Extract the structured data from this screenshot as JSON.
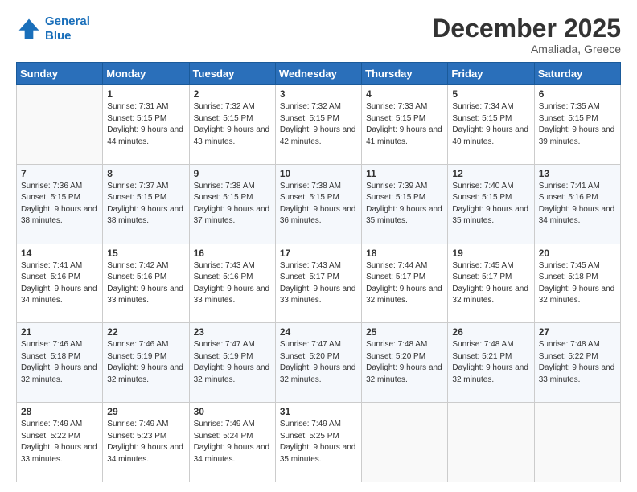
{
  "header": {
    "logo_line1": "General",
    "logo_line2": "Blue",
    "month": "December 2025",
    "location": "Amaliada, Greece"
  },
  "weekdays": [
    "Sunday",
    "Monday",
    "Tuesday",
    "Wednesday",
    "Thursday",
    "Friday",
    "Saturday"
  ],
  "weeks": [
    [
      {
        "day": "",
        "sunrise": "",
        "sunset": "",
        "daylight": ""
      },
      {
        "day": "1",
        "sunrise": "7:31 AM",
        "sunset": "5:15 PM",
        "daylight": "9 hours and 44 minutes."
      },
      {
        "day": "2",
        "sunrise": "7:32 AM",
        "sunset": "5:15 PM",
        "daylight": "9 hours and 43 minutes."
      },
      {
        "day": "3",
        "sunrise": "7:32 AM",
        "sunset": "5:15 PM",
        "daylight": "9 hours and 42 minutes."
      },
      {
        "day": "4",
        "sunrise": "7:33 AM",
        "sunset": "5:15 PM",
        "daylight": "9 hours and 41 minutes."
      },
      {
        "day": "5",
        "sunrise": "7:34 AM",
        "sunset": "5:15 PM",
        "daylight": "9 hours and 40 minutes."
      },
      {
        "day": "6",
        "sunrise": "7:35 AM",
        "sunset": "5:15 PM",
        "daylight": "9 hours and 39 minutes."
      }
    ],
    [
      {
        "day": "7",
        "sunrise": "7:36 AM",
        "sunset": "5:15 PM",
        "daylight": "9 hours and 38 minutes."
      },
      {
        "day": "8",
        "sunrise": "7:37 AM",
        "sunset": "5:15 PM",
        "daylight": "9 hours and 38 minutes."
      },
      {
        "day": "9",
        "sunrise": "7:38 AM",
        "sunset": "5:15 PM",
        "daylight": "9 hours and 37 minutes."
      },
      {
        "day": "10",
        "sunrise": "7:38 AM",
        "sunset": "5:15 PM",
        "daylight": "9 hours and 36 minutes."
      },
      {
        "day": "11",
        "sunrise": "7:39 AM",
        "sunset": "5:15 PM",
        "daylight": "9 hours and 35 minutes."
      },
      {
        "day": "12",
        "sunrise": "7:40 AM",
        "sunset": "5:15 PM",
        "daylight": "9 hours and 35 minutes."
      },
      {
        "day": "13",
        "sunrise": "7:41 AM",
        "sunset": "5:16 PM",
        "daylight": "9 hours and 34 minutes."
      }
    ],
    [
      {
        "day": "14",
        "sunrise": "7:41 AM",
        "sunset": "5:16 PM",
        "daylight": "9 hours and 34 minutes."
      },
      {
        "day": "15",
        "sunrise": "7:42 AM",
        "sunset": "5:16 PM",
        "daylight": "9 hours and 33 minutes."
      },
      {
        "day": "16",
        "sunrise": "7:43 AM",
        "sunset": "5:16 PM",
        "daylight": "9 hours and 33 minutes."
      },
      {
        "day": "17",
        "sunrise": "7:43 AM",
        "sunset": "5:17 PM",
        "daylight": "9 hours and 33 minutes."
      },
      {
        "day": "18",
        "sunrise": "7:44 AM",
        "sunset": "5:17 PM",
        "daylight": "9 hours and 32 minutes."
      },
      {
        "day": "19",
        "sunrise": "7:45 AM",
        "sunset": "5:17 PM",
        "daylight": "9 hours and 32 minutes."
      },
      {
        "day": "20",
        "sunrise": "7:45 AM",
        "sunset": "5:18 PM",
        "daylight": "9 hours and 32 minutes."
      }
    ],
    [
      {
        "day": "21",
        "sunrise": "7:46 AM",
        "sunset": "5:18 PM",
        "daylight": "9 hours and 32 minutes."
      },
      {
        "day": "22",
        "sunrise": "7:46 AM",
        "sunset": "5:19 PM",
        "daylight": "9 hours and 32 minutes."
      },
      {
        "day": "23",
        "sunrise": "7:47 AM",
        "sunset": "5:19 PM",
        "daylight": "9 hours and 32 minutes."
      },
      {
        "day": "24",
        "sunrise": "7:47 AM",
        "sunset": "5:20 PM",
        "daylight": "9 hours and 32 minutes."
      },
      {
        "day": "25",
        "sunrise": "7:48 AM",
        "sunset": "5:20 PM",
        "daylight": "9 hours and 32 minutes."
      },
      {
        "day": "26",
        "sunrise": "7:48 AM",
        "sunset": "5:21 PM",
        "daylight": "9 hours and 32 minutes."
      },
      {
        "day": "27",
        "sunrise": "7:48 AM",
        "sunset": "5:22 PM",
        "daylight": "9 hours and 33 minutes."
      }
    ],
    [
      {
        "day": "28",
        "sunrise": "7:49 AM",
        "sunset": "5:22 PM",
        "daylight": "9 hours and 33 minutes."
      },
      {
        "day": "29",
        "sunrise": "7:49 AM",
        "sunset": "5:23 PM",
        "daylight": "9 hours and 34 minutes."
      },
      {
        "day": "30",
        "sunrise": "7:49 AM",
        "sunset": "5:24 PM",
        "daylight": "9 hours and 34 minutes."
      },
      {
        "day": "31",
        "sunrise": "7:49 AM",
        "sunset": "5:25 PM",
        "daylight": "9 hours and 35 minutes."
      },
      {
        "day": "",
        "sunrise": "",
        "sunset": "",
        "daylight": ""
      },
      {
        "day": "",
        "sunrise": "",
        "sunset": "",
        "daylight": ""
      },
      {
        "day": "",
        "sunrise": "",
        "sunset": "",
        "daylight": ""
      }
    ]
  ]
}
